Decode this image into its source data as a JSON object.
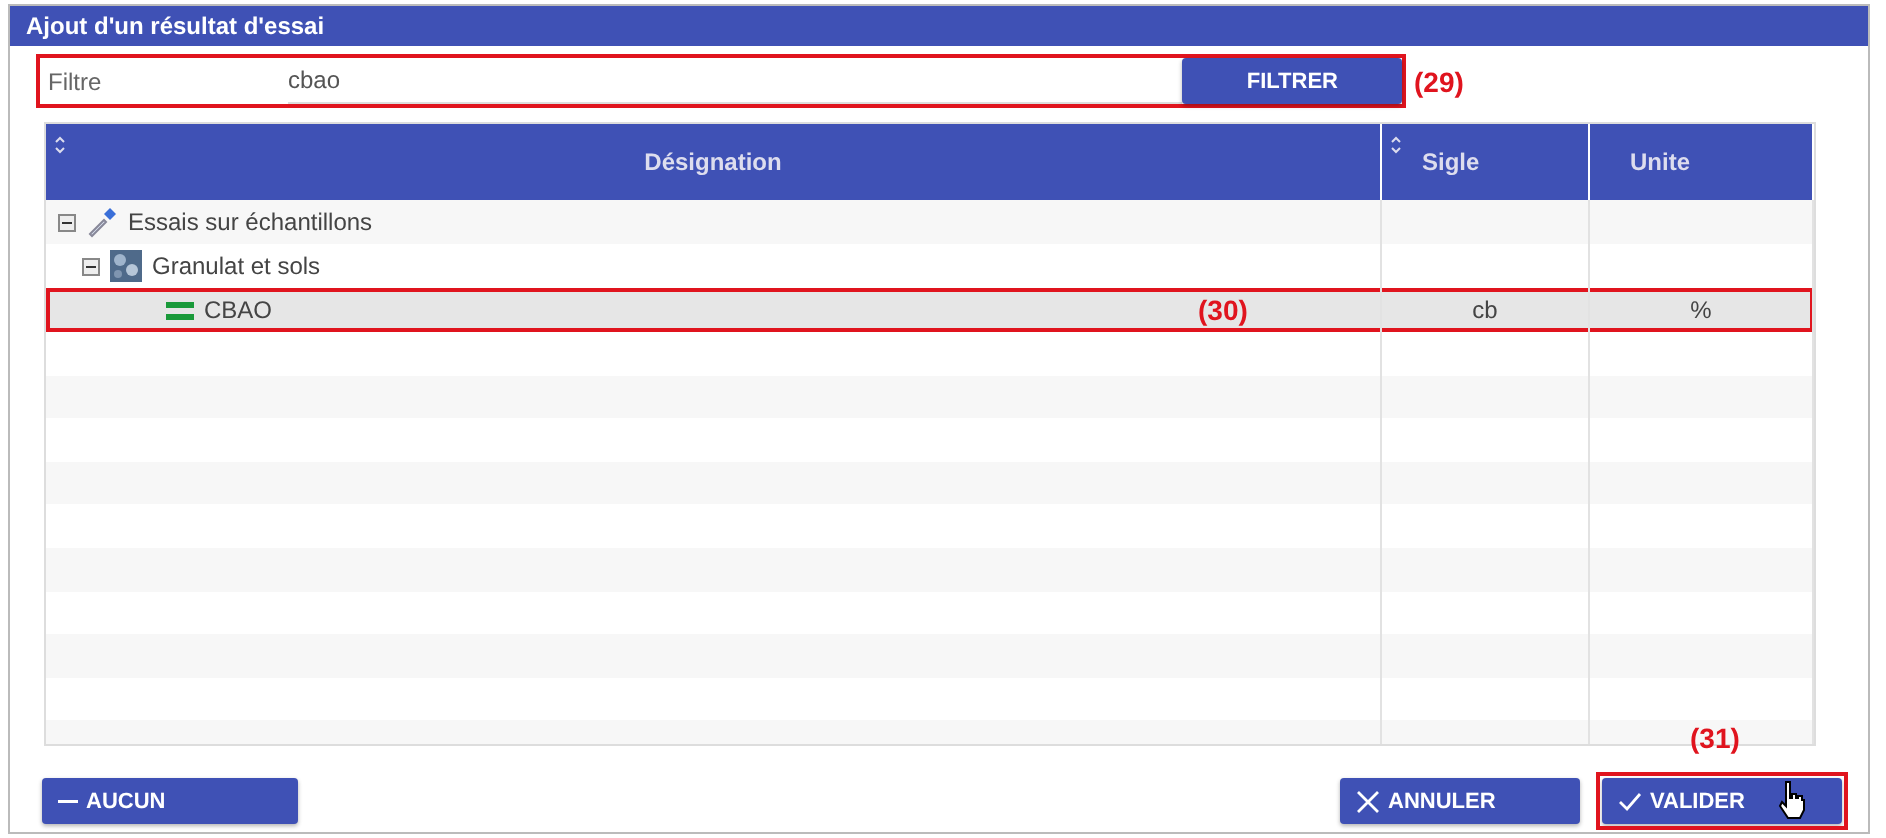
{
  "window": {
    "title": "Ajout d'un résultat d'essai"
  },
  "filter": {
    "label": "Filtre",
    "value": "cbao",
    "button": "FILTRER",
    "annotation": "(29)"
  },
  "table": {
    "columns": [
      {
        "label": "Désignation",
        "sortable": true
      },
      {
        "label": "Sigle",
        "sortable": true
      },
      {
        "label": "Unite",
        "sortable": false
      }
    ],
    "rows": [
      {
        "kind": "group",
        "label": "Essais sur échantillons",
        "expanded": true,
        "selected": false,
        "children": [
          {
            "kind": "group",
            "label": "Granulat et sols",
            "expanded": true,
            "selected": false,
            "children": [
              {
                "kind": "test",
                "label": "CBAO",
                "sigle": "cb",
                "unite": "%",
                "selected": true,
                "annotation": "(30)"
              }
            ]
          }
        ]
      }
    ]
  },
  "buttons": {
    "left": {
      "label": "AUCUN"
    },
    "right": [
      {
        "kind": "cancel",
        "label": "ANNULER"
      },
      {
        "kind": "confirm",
        "label": "VALIDER",
        "annotation": "(31)"
      }
    ]
  }
}
